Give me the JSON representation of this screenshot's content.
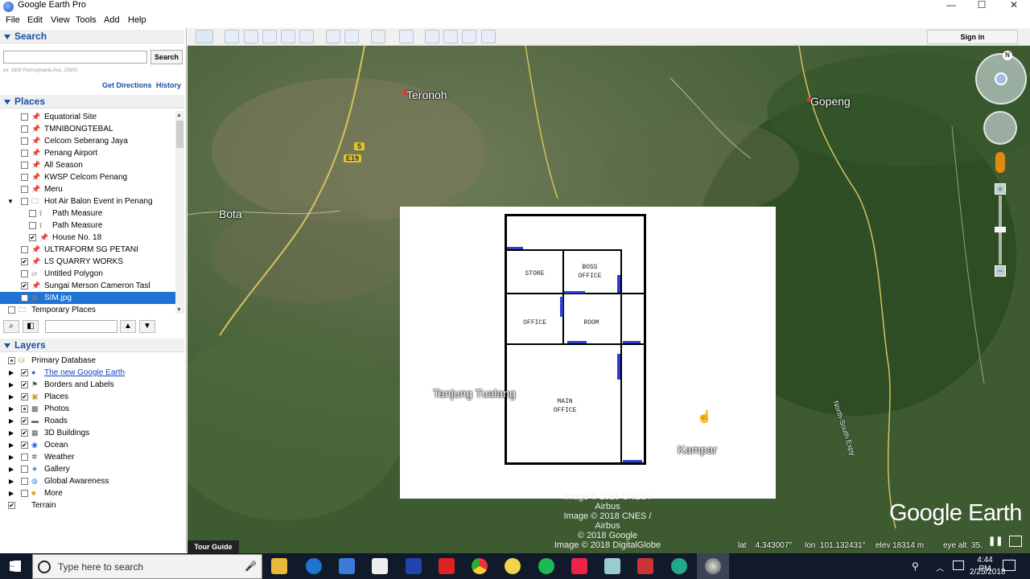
{
  "window": {
    "title": "Google Earth Pro",
    "minimize": "—",
    "maximize": "☐",
    "close": "✕"
  },
  "menu": [
    "File",
    "Edit",
    "View",
    "Tools",
    "Add",
    "Help"
  ],
  "toolbar": {
    "sign_in": "Sign in"
  },
  "search": {
    "header": "Search",
    "button": "Search",
    "placeholder": "",
    "hint": "ex: 1600 Pennsylvania Ave, 20500",
    "get_directions": "Get Directions",
    "history": "History"
  },
  "places": {
    "header": "Places",
    "items": [
      {
        "label": "Equatorial Site",
        "checked": false,
        "icon": "pin-icon",
        "indent": 1
      },
      {
        "label": "TMNIBONGTEBAL",
        "checked": false,
        "icon": "pin-icon",
        "indent": 1
      },
      {
        "label": "Celcom Seberang Jaya",
        "checked": false,
        "icon": "pin-icon",
        "indent": 1
      },
      {
        "label": "Penang Airport",
        "checked": false,
        "icon": "pin-icon",
        "indent": 1
      },
      {
        "label": "All Season",
        "checked": false,
        "icon": "pin-icon",
        "indent": 1
      },
      {
        "label": "KWSP Celcom Penang",
        "checked": false,
        "icon": "pin-icon",
        "indent": 1
      },
      {
        "label": "Meru",
        "checked": false,
        "icon": "pin-icon",
        "indent": 1
      },
      {
        "label": "Hot Air Balon Event in Penang",
        "checked": false,
        "icon": "folder-icon",
        "indent": 1,
        "expanded": true
      },
      {
        "label": "Path Measure",
        "checked": false,
        "icon": "path-icon",
        "indent": 2
      },
      {
        "label": "Path Measure",
        "checked": false,
        "icon": "path-icon",
        "indent": 2
      },
      {
        "label": "House No. 18",
        "checked": true,
        "icon": "pin-icon",
        "indent": 2
      },
      {
        "label": "ULTRAFORM SG PETANI",
        "checked": false,
        "icon": "pin-icon",
        "indent": 1
      },
      {
        "label": "LS QUARRY WORKS",
        "checked": true,
        "icon": "pin-icon",
        "indent": 1
      },
      {
        "label": "Untitled Polygon",
        "checked": false,
        "icon": "polygon-icon",
        "indent": 1
      },
      {
        "label": "Sungai Merson Cameron Tasl",
        "checked": true,
        "icon": "pin-icon",
        "indent": 1
      },
      {
        "label": "SIM.jpg",
        "checked": true,
        "icon": "image-overlay-icon",
        "indent": 1,
        "selected": true
      },
      {
        "label": "Temporary Places",
        "checked": false,
        "icon": "folder-icon",
        "indent": 0
      }
    ]
  },
  "layers": {
    "header": "Layers",
    "items": [
      {
        "label": "Primary Database",
        "checked": "partial",
        "icon": "database-icon",
        "indent": 0
      },
      {
        "label": "The new Google Earth",
        "checked": true,
        "icon": "globe-icon",
        "indent": 1,
        "link": true
      },
      {
        "label": "Borders and Labels",
        "checked": true,
        "icon": "flag-icon",
        "indent": 1
      },
      {
        "label": "Places",
        "checked": true,
        "icon": "places-icon",
        "indent": 1
      },
      {
        "label": "Photos",
        "checked": "partial",
        "icon": "photo-icon",
        "indent": 1
      },
      {
        "label": "Roads",
        "checked": true,
        "icon": "road-icon",
        "indent": 1
      },
      {
        "label": "3D Buildings",
        "checked": true,
        "icon": "building-icon",
        "indent": 1
      },
      {
        "label": "Ocean",
        "checked": true,
        "icon": "ocean-icon",
        "indent": 1
      },
      {
        "label": "Weather",
        "checked": false,
        "icon": "weather-icon",
        "indent": 1
      },
      {
        "label": "Gallery",
        "checked": false,
        "icon": "gallery-icon",
        "indent": 1
      },
      {
        "label": "Global Awareness",
        "checked": false,
        "icon": "awareness-icon",
        "indent": 1
      },
      {
        "label": "More",
        "checked": false,
        "icon": "more-icon",
        "indent": 1
      },
      {
        "label": "Terrain",
        "checked": true,
        "icon": "",
        "indent": 0
      }
    ]
  },
  "map": {
    "cities": [
      "Teronoh",
      "Gopeng",
      "Bota",
      "Tanjung Tualang",
      "Kampar"
    ],
    "road_labels": [
      "5",
      "E19"
    ],
    "highway_label": "North-South Expy",
    "overlay_rooms": [
      "STORE",
      "BOSS OFFICE",
      "OFFICE",
      "ROOM",
      "MAIN OFFICE"
    ],
    "imagery_credits": [
      "Image © 2018 CNES / Airbus",
      "Image © 2018 CNES / Airbus",
      "© 2018 Google",
      "Image © 2018 DigitalGlobe"
    ],
    "logo": "Google Earth",
    "tour_guide": "Tour Guide",
    "status": {
      "lat": "lat    4.343007°",
      "lon": "lon  101.132431°",
      "elev": "elev 18314 m",
      "eye": "eye alt  35."
    }
  },
  "taskbar": {
    "search_placeholder": "Type here to search",
    "time": "4:44 PM",
    "date": "2/25/2018"
  }
}
